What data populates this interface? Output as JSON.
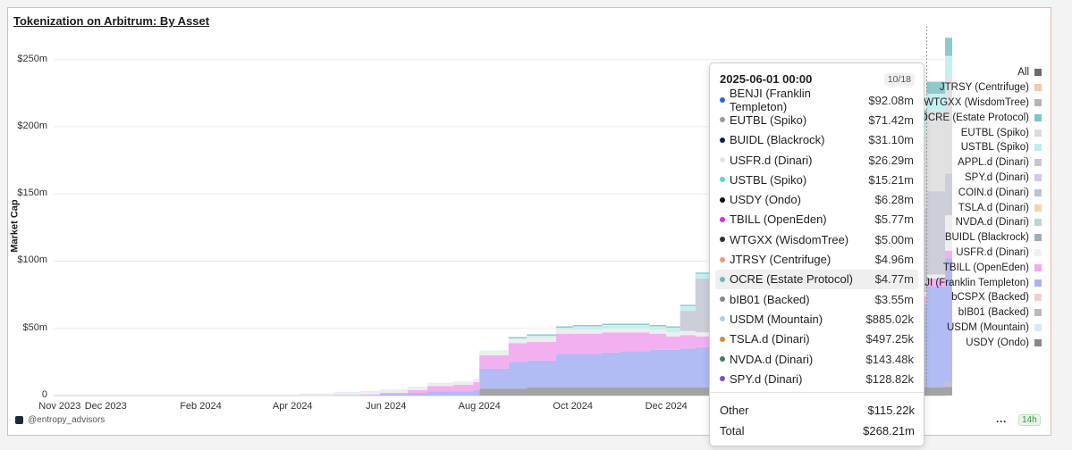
{
  "title": "Tokenization on Arbitrum: By Asset",
  "watermark": "@entropy_advisors",
  "refresh_badge": "14h",
  "more_label": "···",
  "chart_data": {
    "type": "area",
    "title": "Tokenization on Arbitrum: By Asset",
    "ylabel": "Market Cap",
    "xlabel": "",
    "ylim": [
      0,
      275
    ],
    "y_ticks": [
      "0",
      "$50m",
      "$100m",
      "$150m",
      "$200m",
      "$250m"
    ],
    "x_ticks": [
      "Nov 2023",
      "Dec 2023",
      "Feb 2024",
      "Apr 2024",
      "Jun 2024",
      "Aug 2024",
      "Oct 2024",
      "Dec 2024"
    ],
    "grid": true,
    "legend_position": "right",
    "stacked": true,
    "legend": [
      {
        "name": "All",
        "color": "#6b6b6b"
      },
      {
        "name": "JTRSY (Centrifuge)",
        "color": "#f4c9b3"
      },
      {
        "name": "WTGXX (WisdomTree)",
        "color": "#b5b5b5"
      },
      {
        "name": "OCRE (Estate Protocol)",
        "color": "#7fc4c9"
      },
      {
        "name": "EUTBL (Spiko)",
        "color": "#dcdcdc"
      },
      {
        "name": "USTBL (Spiko)",
        "color": "#bfeeee"
      },
      {
        "name": "APPL.d (Dinari)",
        "color": "#c7c7c7"
      },
      {
        "name": "SPY.d (Dinari)",
        "color": "#d5c6ef"
      },
      {
        "name": "COIN.d (Dinari)",
        "color": "#bcc3d1"
      },
      {
        "name": "TSLA.d (Dinari)",
        "color": "#f6d2b0"
      },
      {
        "name": "NVDA.d (Dinari)",
        "color": "#b9d9cf"
      },
      {
        "name": "BUIDL (Blackrock)",
        "color": "#a4a9bd"
      },
      {
        "name": "USFR.d (Dinari)",
        "color": "#f0f0f0"
      },
      {
        "name": "TBILL (OpenEden)",
        "color": "#f2a7ee"
      },
      {
        "name": "BENJI (Franklin Templeton)",
        "color": "#aab4f3"
      },
      {
        "name": "bCSPX (Backed)",
        "color": "#f6cccc"
      },
      {
        "name": "bIB01 (Backed)",
        "color": "#bbbbbb"
      },
      {
        "name": "USDM (Mountain)",
        "color": "#d6e9f6"
      },
      {
        "name": "USDY (Ondo)",
        "color": "#888888"
      }
    ],
    "x": [
      "2023-10-28",
      "2023-11-28",
      "2023-12-28",
      "2024-01-28",
      "2024-02-28",
      "2024-03-28",
      "2024-04-05",
      "2024-04-28",
      "2024-05-15",
      "2024-05-28",
      "2024-06-15",
      "2024-06-28",
      "2024-07-15",
      "2024-07-28",
      "2024-08-01",
      "2024-08-20",
      "2024-09-01",
      "2024-09-20",
      "2024-10-01",
      "2024-10-20",
      "2024-11-01",
      "2024-11-20",
      "2024-12-01",
      "2024-12-10",
      "2024-12-20",
      "2025-01-01",
      "2025-01-20",
      "2025-02-01",
      "2025-02-20",
      "2025-03-01",
      "2025-03-20",
      "2025-04-01",
      "2025-04-20",
      "2025-05-01",
      "2025-05-20",
      "2025-06-01"
    ],
    "series": [
      {
        "name": "USDY (Ondo)",
        "color": "#9a9a9a",
        "values": [
          0,
          0,
          0,
          0,
          0,
          0,
          0,
          0,
          0,
          0,
          0,
          0,
          0,
          0,
          5,
          5,
          6,
          6,
          6,
          6,
          6,
          6,
          6,
          6,
          6,
          6,
          6,
          6,
          6,
          6,
          6,
          6,
          6,
          6,
          6,
          6.3
        ]
      },
      {
        "name": "bIB01 (Backed)",
        "color": "#bdbdbd",
        "values": [
          0,
          0,
          0,
          0,
          0,
          0,
          0,
          0,
          0,
          0,
          0,
          0,
          0,
          0,
          0,
          0,
          0,
          0,
          0,
          0,
          0,
          0,
          0,
          0,
          0,
          0,
          0,
          0,
          0,
          0,
          0,
          0,
          0,
          0,
          0,
          3.6
        ]
      },
      {
        "name": "BENJI (Franklin Templeton)",
        "color": "#aab4f3",
        "values": [
          0,
          0,
          0,
          0,
          0,
          0,
          0,
          0,
          0,
          1,
          2,
          3,
          3,
          4,
          15,
          20,
          20,
          25,
          25,
          26,
          27,
          28,
          28,
          29,
          30,
          33,
          35,
          40,
          45,
          48,
          52,
          55,
          58,
          62,
          75,
          92.1
        ]
      },
      {
        "name": "TBILL (OpenEden)",
        "color": "#f2a7ee",
        "values": [
          0,
          0,
          0,
          0,
          0,
          0,
          0,
          0.5,
          0.8,
          1,
          2,
          4,
          5,
          6,
          10,
          14,
          14,
          15,
          15,
          15,
          14,
          12,
          10,
          10,
          8,
          7,
          7,
          6,
          6,
          6,
          6,
          6,
          6,
          6,
          6,
          5.8
        ]
      },
      {
        "name": "USFR.d (Dinari)",
        "color": "#ececec",
        "values": [
          0,
          0,
          0,
          0,
          0,
          0,
          1,
          1.5,
          2,
          2,
          2,
          2,
          2,
          2,
          3,
          3,
          3,
          3,
          3,
          3,
          3,
          3,
          3,
          3,
          3,
          3,
          3,
          3,
          3,
          3,
          3,
          3,
          3,
          3,
          3,
          26.3
        ]
      },
      {
        "name": "BUIDL (Blackrock)",
        "color": "#c6cad6",
        "values": [
          0,
          0,
          0,
          0,
          0,
          0,
          0,
          0,
          0,
          0,
          0,
          0,
          0,
          0,
          0,
          0,
          0,
          0,
          0,
          0,
          0,
          0,
          0,
          15,
          40,
          45,
          50,
          55,
          60,
          62,
          62,
          62,
          62,
          62,
          62,
          31.1
        ]
      },
      {
        "name": "EUTBL (Spiko)",
        "color": "#dedede",
        "values": [
          0,
          0,
          0,
          0,
          0,
          0,
          0,
          0,
          0,
          0,
          0,
          0,
          0,
          0,
          0,
          0,
          0,
          0,
          0,
          0,
          0,
          0,
          0,
          0,
          0,
          0,
          0,
          0,
          0,
          10,
          25,
          35,
          45,
          55,
          60,
          71.4
        ]
      },
      {
        "name": "USTBL (Spiko)",
        "color": "#bfeeee",
        "values": [
          0,
          0,
          0,
          0,
          0,
          0,
          0,
          0,
          0,
          0,
          0,
          0,
          0,
          0,
          0,
          0,
          1,
          1,
          2,
          2,
          2,
          2,
          3,
          3,
          3,
          3,
          3,
          3,
          4,
          4,
          5,
          6,
          8,
          10,
          12,
          15.2
        ]
      },
      {
        "name": "USDM (Mountain)",
        "color": "#d6e9f6",
        "values": [
          0,
          0,
          0,
          0,
          0,
          0,
          0.5,
          0.5,
          0.5,
          0.5,
          0.5,
          0.5,
          0.5,
          0.5,
          0.5,
          0.5,
          0.5,
          0.5,
          0.5,
          0.5,
          0.5,
          0.5,
          0.5,
          0.5,
          0.5,
          0.5,
          0.5,
          0.5,
          0.5,
          0.5,
          0.5,
          0.5,
          0.5,
          0.5,
          0.5,
          0.9
        ]
      },
      {
        "name": "Other",
        "color": "#7fc4c9",
        "values": [
          0,
          0,
          0,
          0,
          0,
          0,
          0,
          0,
          0,
          0,
          0,
          0,
          0,
          0,
          0,
          1,
          1,
          1,
          1,
          1,
          1,
          1,
          1,
          1,
          1,
          2,
          2,
          3,
          3,
          4,
          4,
          5,
          6,
          8,
          9,
          13.5
        ]
      }
    ]
  },
  "tooltip": {
    "date": "2025-06-01 00:00",
    "page": "10/18",
    "rows": [
      {
        "name": "BENJI (Franklin Templeton)",
        "value": "$92.08m",
        "color": "#2f5fe8"
      },
      {
        "name": "EUTBL (Spiko)",
        "value": "$71.42m",
        "color": "#9b9b9b"
      },
      {
        "name": "BUIDL (Blackrock)",
        "value": "$31.10m",
        "color": "#161f52"
      },
      {
        "name": "USFR.d (Dinari)",
        "value": "$26.29m",
        "color": "#e4e4e4"
      },
      {
        "name": "USTBL (Spiko)",
        "value": "$15.21m",
        "color": "#58d6cb"
      },
      {
        "name": "USDY (Ondo)",
        "value": "$6.28m",
        "color": "#111111"
      },
      {
        "name": "TBILL (OpenEden)",
        "value": "$5.77m",
        "color": "#d92fd0"
      },
      {
        "name": "WTGXX (WisdomTree)",
        "value": "$5.00m",
        "color": "#26323f"
      },
      {
        "name": "JTRSY (Centrifuge)",
        "value": "$4.96m",
        "color": "#ef9a76"
      },
      {
        "name": "OCRE (Estate Protocol)",
        "value": "$4.77m",
        "color": "#6fb8c6"
      },
      {
        "name": "bIB01 (Backed)",
        "value": "$3.55m",
        "color": "#888888"
      },
      {
        "name": "USDM (Mountain)",
        "value": "$885.02k",
        "color": "#a9d1f0"
      },
      {
        "name": "TSLA.d (Dinari)",
        "value": "$497.25k",
        "color": "#d88a3a"
      },
      {
        "name": "NVDA.d (Dinari)",
        "value": "$143.48k",
        "color": "#3f7a6c"
      },
      {
        "name": "SPY.d (Dinari)",
        "value": "$128.82k",
        "color": "#7a4fc2"
      }
    ],
    "highlight_index": 9,
    "other_label": "Other",
    "other_value": "$115.22k",
    "total_label": "Total",
    "total_value": "$268.21m"
  }
}
